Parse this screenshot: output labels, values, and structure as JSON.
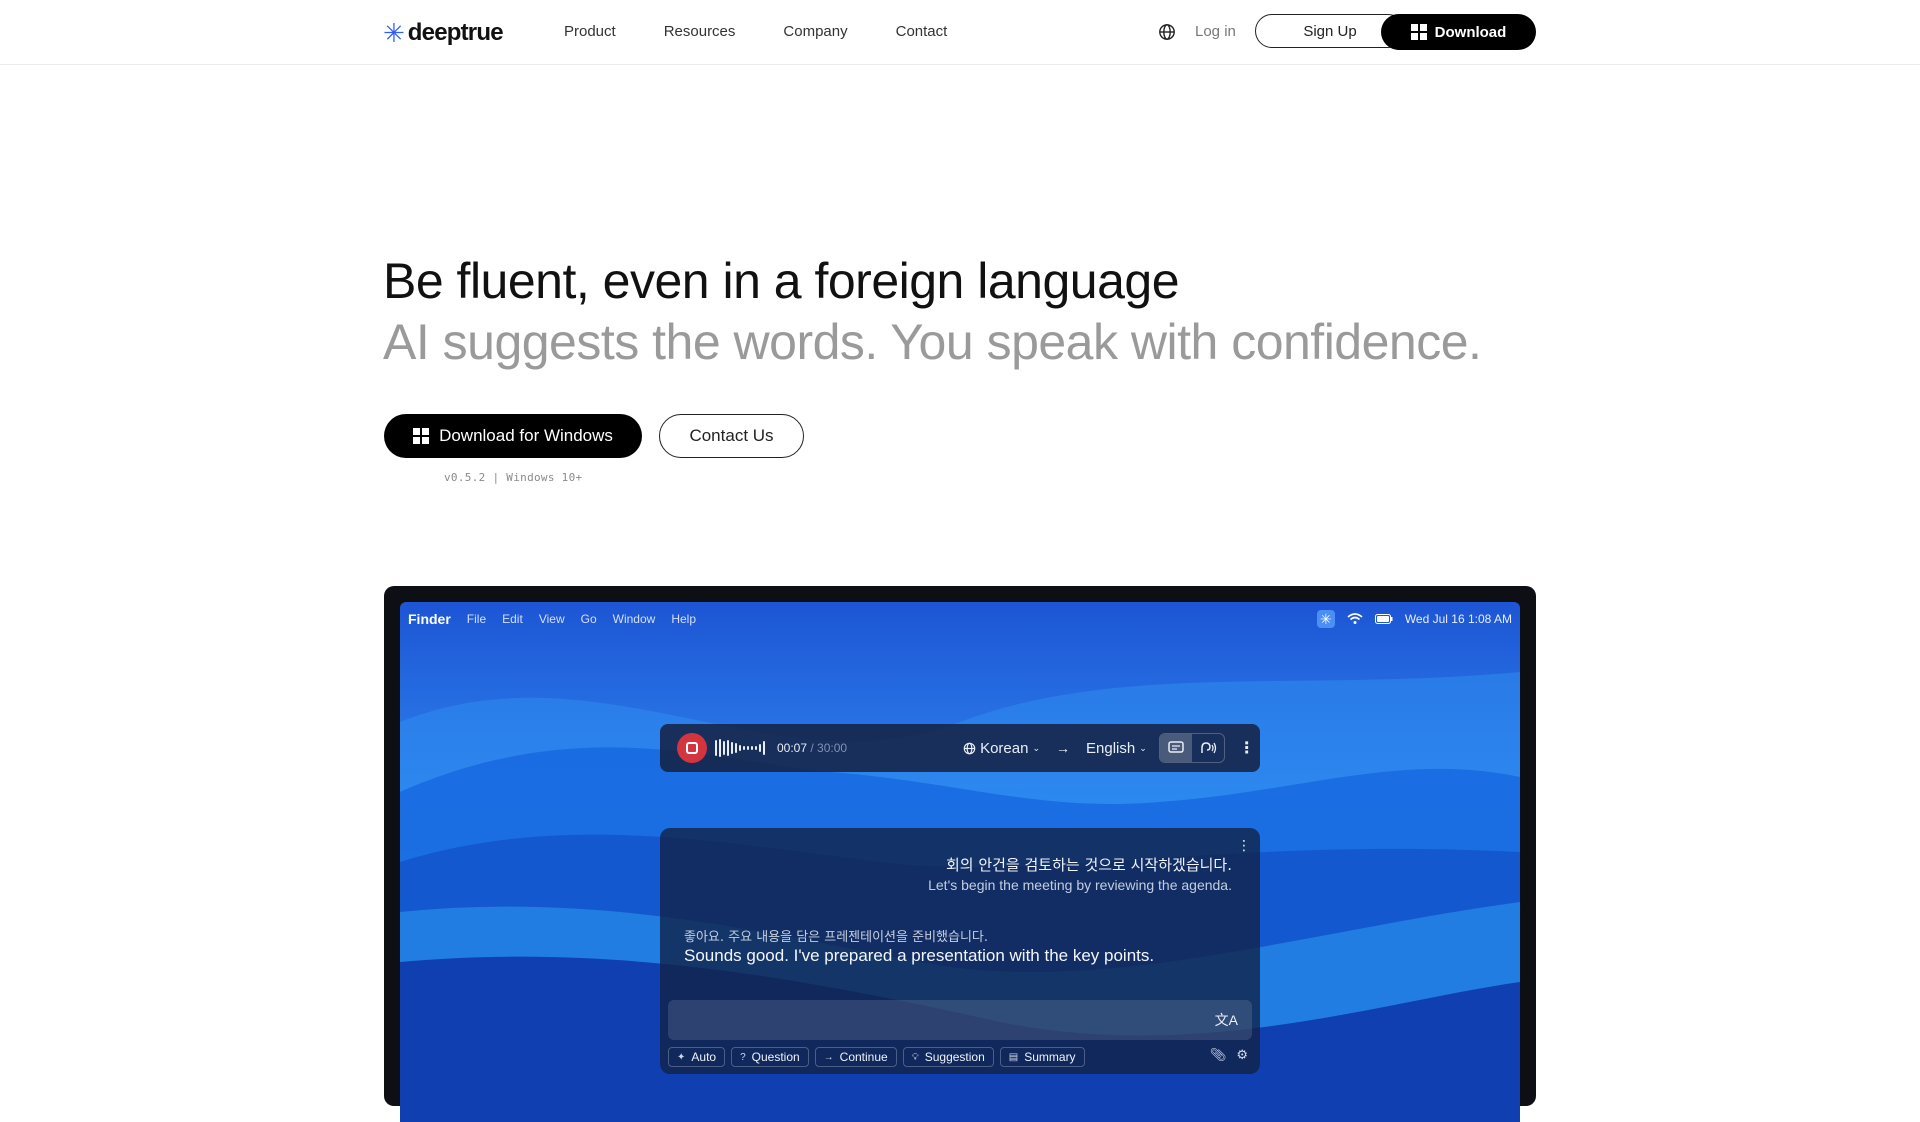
{
  "nav": {
    "logo_mark": "✳",
    "logo_text": "deeptrue",
    "menu": [
      "Product",
      "Resources",
      "Company",
      "Contact"
    ],
    "globe_icon": "globe-icon",
    "login": "Log in",
    "signup": "Sign Up",
    "download": "Download"
  },
  "hero": {
    "headline": "Be fluent, even in a foreign language",
    "subheadline": "AI suggests the words. You speak with confidence.",
    "download_windows": "Download for Windows",
    "contact_us": "Contact Us",
    "version": "v0.5.2 | Windows 10+"
  },
  "mockup": {
    "menubar": {
      "app": "Finder",
      "items": [
        "File",
        "Edit",
        "View",
        "Go",
        "Window",
        "Help"
      ],
      "datetime": "Wed Jul 16 1:08 AM"
    },
    "toolbar": {
      "elapsed": "00:07",
      "total": "/ 30:00",
      "source_lang": "Korean",
      "target_lang": "English"
    },
    "transcript": {
      "line1_ko": "회의 안건을 검토하는 것으로 시작하겠습니다.",
      "line1_en": "Let's begin the meeting by reviewing the agenda.",
      "line2_ko": "좋아요. 주요 내용을 담은 프레젠테이션을 준비했습니다.",
      "line2_en": "Sounds good. I've prepared a presentation with the key points."
    },
    "chips": [
      "Auto",
      "Question",
      "Continue",
      "Suggestion",
      "Summary"
    ]
  },
  "colors": {
    "brand": "#2f5bff",
    "record": "#d2353d",
    "primary_button": "#000000"
  }
}
